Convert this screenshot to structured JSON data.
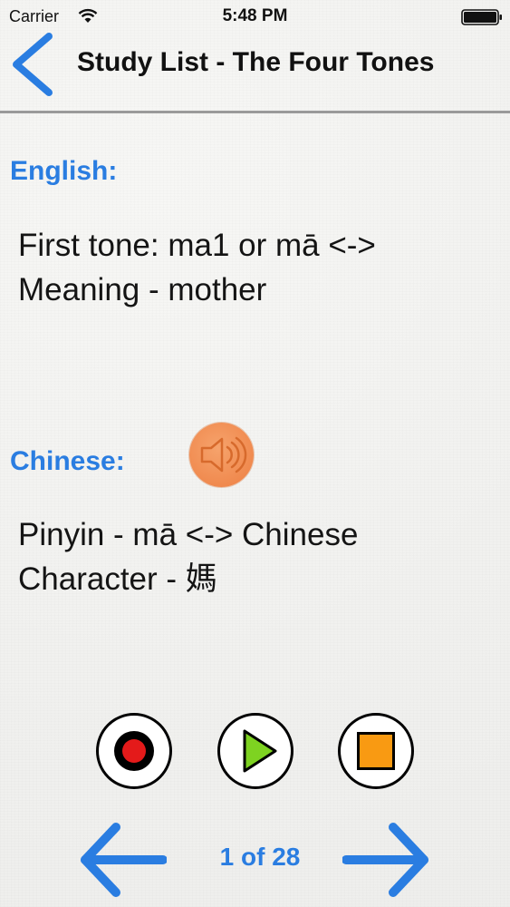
{
  "status_bar": {
    "carrier": "Carrier",
    "time": "5:48 PM",
    "wifi_icon": "wifi-icon",
    "battery_icon": "battery-icon"
  },
  "nav": {
    "back_icon": "chevron-left-icon",
    "title": "Study List - The Four Tones"
  },
  "english": {
    "label": "English:",
    "lines": [
      "First tone: ma1 or mā <->",
      "Meaning - mother"
    ]
  },
  "chinese": {
    "label": "Chinese:",
    "speaker_icon": "speaker-icon",
    "lines": [
      "Pinyin - mā <-> Chinese",
      "Character - 媽"
    ]
  },
  "controls": {
    "record_icon": "record-icon",
    "play_icon": "play-icon",
    "stop_icon": "stop-icon"
  },
  "pager": {
    "prev_icon": "arrow-left-icon",
    "next_icon": "arrow-right-icon",
    "indicator": "1 of 28"
  },
  "colors": {
    "accent_blue": "#2a7de1",
    "speaker_orange": "#f08a4f",
    "record_red": "#e41a1a",
    "play_green": "#7ed321",
    "stop_orange": "#f99a12"
  }
}
